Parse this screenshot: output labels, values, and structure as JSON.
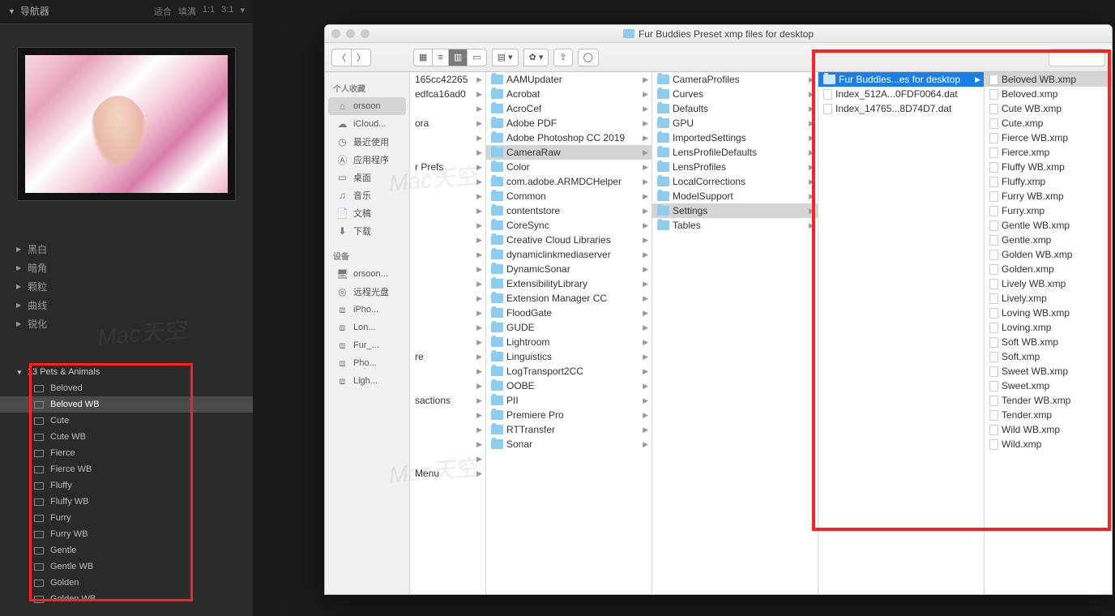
{
  "lr": {
    "nav_title": "导航器",
    "nav_opts": [
      "适合",
      "填满",
      "1:1",
      "3:1"
    ],
    "sections": [
      "黑白",
      "暗角",
      "颗粒",
      "曲线",
      "锐化"
    ],
    "preset_group": "13 Pets & Animals",
    "presets": [
      "Beloved",
      "Beloved WB",
      "Cute",
      "Cute WB",
      "Fierce",
      "Fierce WB",
      "Fluffy",
      "Fluffy WB",
      "Furry",
      "Furry WB",
      "Gentle",
      "Gentle WB",
      "Golden",
      "Golden WB"
    ],
    "preset_selected": "Beloved WB"
  },
  "finder": {
    "title": "Fur Buddies Preset xmp files for desktop",
    "sidebar": {
      "fav_hdr": "个人收藏",
      "favs": [
        {
          "icon": "home",
          "label": "orsoon",
          "sel": true
        },
        {
          "icon": "cloud",
          "label": "iCloud..."
        },
        {
          "icon": "clock",
          "label": "最近使用"
        },
        {
          "icon": "app",
          "label": "应用程序"
        },
        {
          "icon": "desk",
          "label": "桌面"
        },
        {
          "icon": "music",
          "label": "音乐"
        },
        {
          "icon": "doc",
          "label": "文稿"
        },
        {
          "icon": "down",
          "label": "下载"
        }
      ],
      "dev_hdr": "设备",
      "devs": [
        {
          "icon": "disp",
          "label": "orsoon..."
        },
        {
          "icon": "disc",
          "label": "远程光盘"
        },
        {
          "icon": "ext",
          "label": "iPho..."
        },
        {
          "icon": "ext",
          "label": "Lon..."
        },
        {
          "icon": "ext",
          "label": "Fur_..."
        },
        {
          "icon": "ext",
          "label": "Pho..."
        },
        {
          "icon": "ext",
          "label": "Ligh..."
        }
      ]
    },
    "col1": [
      "165cc42265",
      "edfca16ad0",
      "",
      "ora",
      "",
      "",
      "r Prefs",
      "",
      "",
      "",
      "",
      "",
      "",
      "",
      "",
      "",
      "",
      "",
      "",
      "re",
      "",
      "",
      "sactions",
      "",
      "",
      "",
      "",
      "Menu"
    ],
    "col2": [
      "AAMUpdater",
      "Acrobat",
      "AcroCef",
      "Adobe PDF",
      "Adobe Photoshop CC 2019",
      "CameraRaw",
      "Color",
      "com.adobe.ARMDCHelper",
      "Common",
      "contentstore",
      "CoreSync",
      "Creative Cloud Libraries",
      "dynamiclinkmediaserver",
      "DynamicSonar",
      "ExtensibilityLibrary",
      "Extension Manager CC",
      "FloodGate",
      "GUDE",
      "Lightroom",
      "Linguistics",
      "LogTransport2CC",
      "OOBE",
      "PII",
      "Premiere Pro",
      "RTTransfer",
      "Sonar"
    ],
    "col2_sel": "CameraRaw",
    "col3": [
      "CameraProfiles",
      "Curves",
      "Defaults",
      "GPU",
      "ImportedSettings",
      "LensProfileDefaults",
      "LensProfiles",
      "LocalCorrections",
      "ModelSupport",
      "Settings",
      "Tables"
    ],
    "col3_sel": "Settings",
    "col4": [
      {
        "t": "folder",
        "n": "Fur Buddies...es for desktop",
        "sel": true
      },
      {
        "t": "doc",
        "n": "Index_512A...0FDF0064.dat"
      },
      {
        "t": "doc",
        "n": "Index_14765...8D74D7.dat"
      }
    ],
    "col5": [
      "Beloved WB.xmp",
      "Beloved.xmp",
      "Cute WB.xmp",
      "Cute.xmp",
      "Fierce WB.xmp",
      "Fierce.xmp",
      "Fluffy WB.xmp",
      "Fluffy.xmp",
      "Furry WB.xmp",
      "Furry.xmp",
      "Gentle WB.xmp",
      "Gentle.xmp",
      "Golden WB.xmp",
      "Golden.xmp",
      "Lively WB.xmp",
      "Lively.xmp",
      "Loving WB.xmp",
      "Loving.xmp",
      "Soft WB.xmp",
      "Soft.xmp",
      "Sweet WB.xmp",
      "Sweet.xmp",
      "Tender WB.xmp",
      "Tender.xmp",
      "Wild WB.xmp",
      "Wild.xmp"
    ],
    "col5_sel": "Beloved WB.xmp"
  },
  "icons": {
    "home": "⌂",
    "cloud": "☁",
    "clock": "◷",
    "app": "Ⓐ",
    "desk": "▭",
    "music": "♫",
    "doc": "📄",
    "down": "⬇",
    "disp": "🖥",
    "disc": "◎",
    "ext": "⧈"
  }
}
